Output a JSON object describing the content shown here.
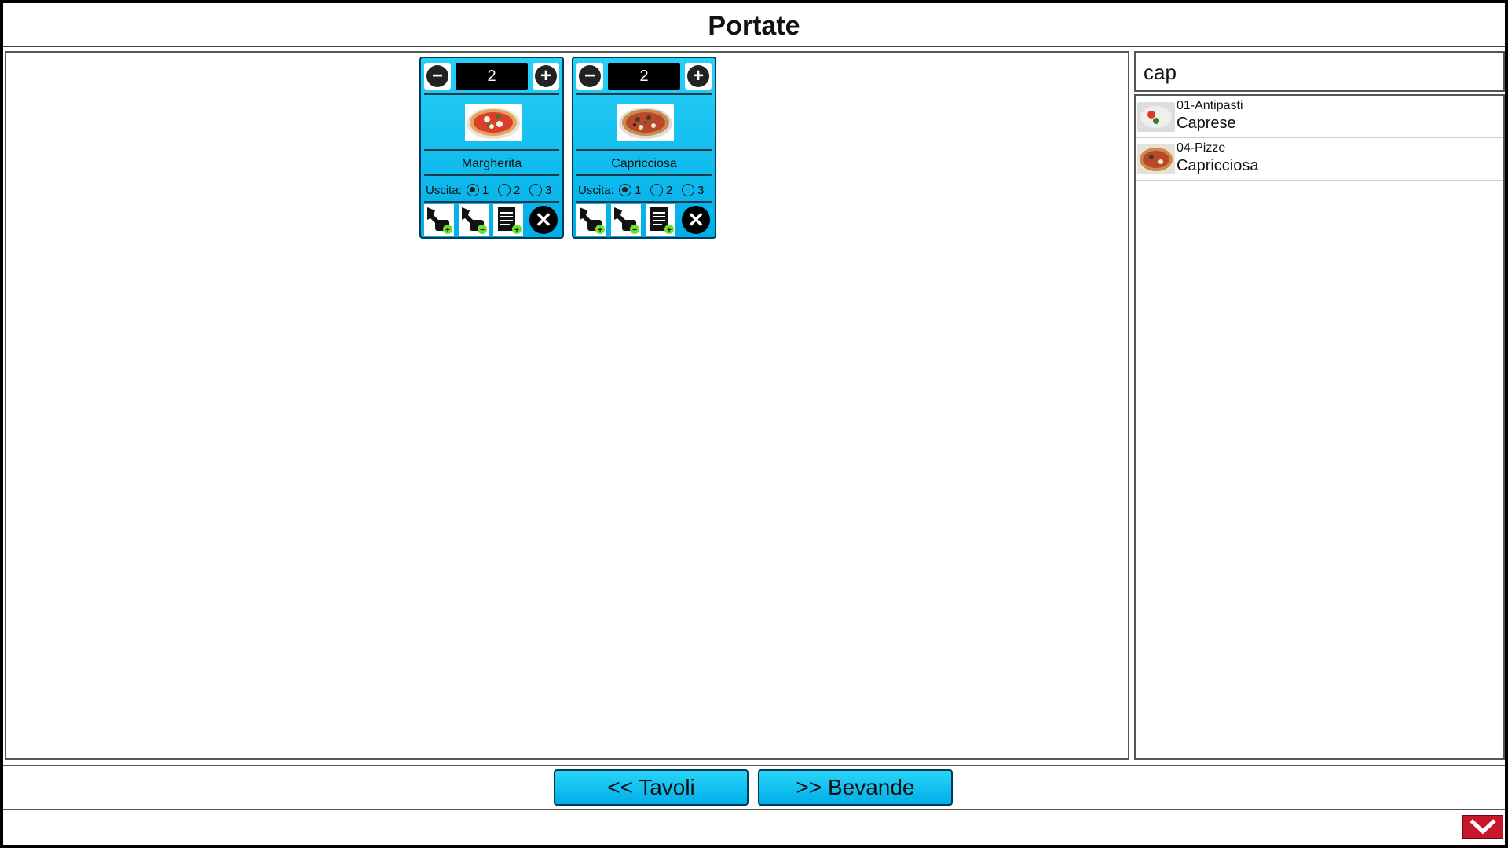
{
  "header": {
    "title": "Portate"
  },
  "search": {
    "value": "cap"
  },
  "results": [
    {
      "category": "01-Antipasti",
      "name": "Caprese"
    },
    {
      "category": "04-Pizze",
      "name": "Capricciosa"
    }
  ],
  "cards": [
    {
      "qty": "2",
      "name": "Margherita",
      "uscita_label": "Uscita:",
      "opt1": "1",
      "opt2": "2",
      "opt3": "3",
      "selected_course": "1"
    },
    {
      "qty": "2",
      "name": "Capricciosa",
      "uscita_label": "Uscita:",
      "opt1": "1",
      "opt2": "2",
      "opt3": "3",
      "selected_course": "1"
    }
  ],
  "footer": {
    "prev_label": "<< Tavoli",
    "next_label": ">> Bevande"
  },
  "colors": {
    "accent": "#00aee8",
    "close": "#c8162a"
  }
}
